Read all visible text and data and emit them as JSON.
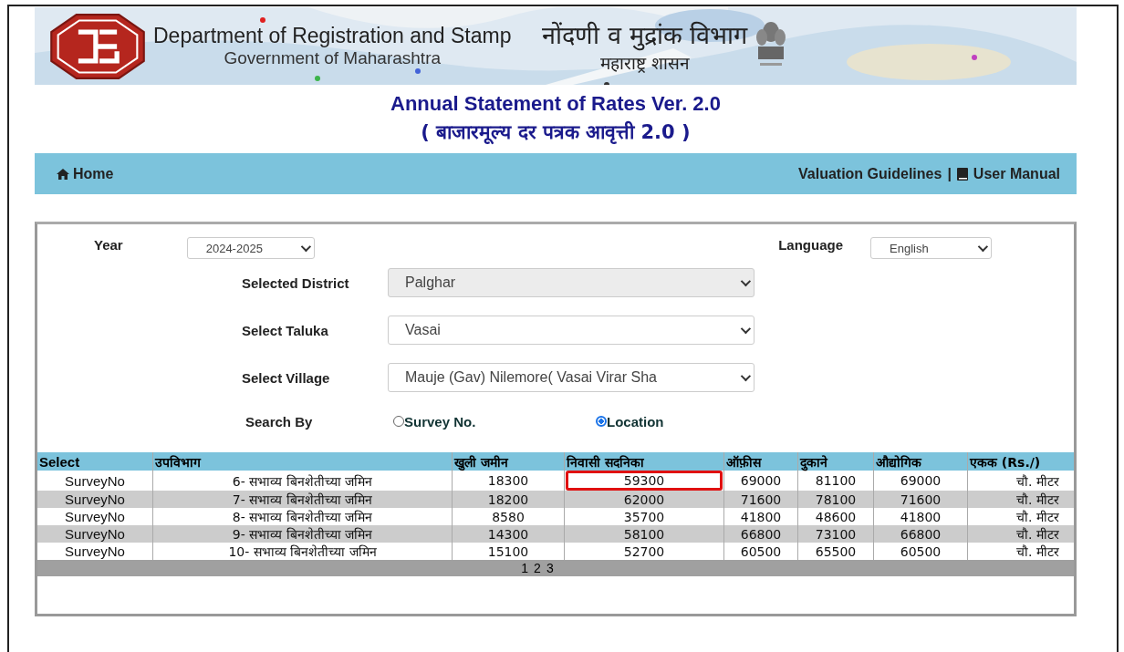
{
  "header": {
    "title_en": "Department of Registration and Stamp",
    "subtitle_en": "Government of Maharashtra",
    "title_mr": "नोंदणी व मुद्रांक विभाग",
    "subtitle_mr": "महाराष्ट्र शासन"
  },
  "page_title": [
    "Annual Statement of Rates Ver. 2.0",
    "( बाजारमूल्य दर पत्रक आवृत्ती 2.0 )"
  ],
  "nav": {
    "home": "Home",
    "links": [
      "Valuation Guidelines",
      "User Manual"
    ],
    "separator": "|"
  },
  "form": {
    "year": {
      "label": "Year",
      "value": "2024-2025"
    },
    "language": {
      "label": "Language",
      "value": "English"
    },
    "fields": [
      {
        "label": "Selected District",
        "value": "Palghar",
        "disabled": true
      },
      {
        "label": "Select Taluka",
        "value": "Vasai",
        "disabled": false
      },
      {
        "label": "Select Village",
        "value": "Mauje (Gav) Nilemore( Vasai Virar Sha",
        "disabled": false
      }
    ],
    "search_by": {
      "label": "Search By",
      "options": [
        {
          "label": "Survey No.",
          "selected": false
        },
        {
          "label": "Location",
          "selected": true
        }
      ]
    }
  },
  "table": {
    "columns": [
      "Select",
      "उपविभाग",
      "खुली जमीन",
      "निवासी सदनिका",
      "ऑफ़ीस",
      "दुकाने",
      "औद्योगिक",
      "एकक (Rs./)"
    ],
    "rows": [
      {
        "cells": [
          {
            "text": "SurveyNo",
            "highlighted": false
          },
          {
            "text": "6- सभाव्य बिनशेतीच्या जमिन",
            "highlighted": false
          },
          {
            "text": "18300",
            "highlighted": false
          },
          {
            "text": "59300",
            "highlighted": true
          },
          {
            "text": "69000",
            "highlighted": false
          },
          {
            "text": "81100",
            "highlighted": false
          },
          {
            "text": "69000",
            "highlighted": false
          },
          {
            "text": "चौ. मीटर",
            "highlighted": false
          }
        ]
      },
      {
        "cells": [
          {
            "text": "SurveyNo",
            "highlighted": false
          },
          {
            "text": "7- सभाव्य बिनशेतीच्या जमिन",
            "highlighted": false
          },
          {
            "text": "18200",
            "highlighted": false
          },
          {
            "text": "62000",
            "highlighted": false
          },
          {
            "text": "71600",
            "highlighted": false
          },
          {
            "text": "78100",
            "highlighted": false
          },
          {
            "text": "71600",
            "highlighted": false
          },
          {
            "text": "चौ. मीटर",
            "highlighted": false
          }
        ]
      },
      {
        "cells": [
          {
            "text": "SurveyNo",
            "highlighted": false
          },
          {
            "text": "8- सभाव्य बिनशेतीच्या जमिन",
            "highlighted": false
          },
          {
            "text": "8580",
            "highlighted": false
          },
          {
            "text": "35700",
            "highlighted": false
          },
          {
            "text": "41800",
            "highlighted": false
          },
          {
            "text": "48600",
            "highlighted": false
          },
          {
            "text": "41800",
            "highlighted": false
          },
          {
            "text": "चौ. मीटर",
            "highlighted": false
          }
        ]
      },
      {
        "cells": [
          {
            "text": "SurveyNo",
            "highlighted": false
          },
          {
            "text": "9- सभाव्य बिनशेतीच्या जमिन",
            "highlighted": false
          },
          {
            "text": "14300",
            "highlighted": false
          },
          {
            "text": "58100",
            "highlighted": false
          },
          {
            "text": "66800",
            "highlighted": false
          },
          {
            "text": "73100",
            "highlighted": false
          },
          {
            "text": "66800",
            "highlighted": false
          },
          {
            "text": "चौ. मीटर",
            "highlighted": false
          }
        ]
      },
      {
        "cells": [
          {
            "text": "SurveyNo",
            "highlighted": false
          },
          {
            "text": "10- सभाव्य बिनशेतीच्या जमिन",
            "highlighted": false
          },
          {
            "text": "15100",
            "highlighted": false
          },
          {
            "text": "52700",
            "highlighted": false
          },
          {
            "text": "60500",
            "highlighted": false
          },
          {
            "text": "65500",
            "highlighted": false
          },
          {
            "text": "60500",
            "highlighted": false
          },
          {
            "text": "चौ. मीटर",
            "highlighted": false
          }
        ]
      }
    ],
    "pages": [
      "1",
      "2",
      "3"
    ]
  }
}
